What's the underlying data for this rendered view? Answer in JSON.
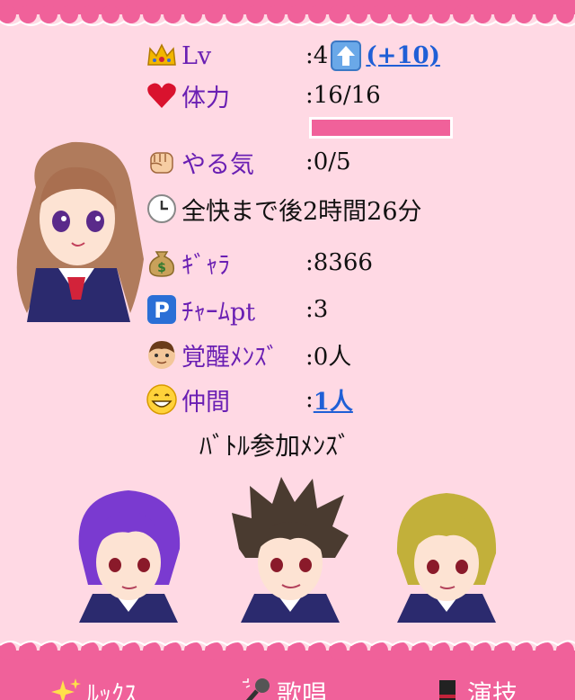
{
  "status": {
    "lv": {
      "label": "Lv",
      "value": ":4",
      "bonus": "(+10)",
      "icon": "crown-icon"
    },
    "hp": {
      "label": "体力",
      "value": ":16/16",
      "icon": "heart-icon",
      "fill_fraction": 1.0,
      "bar_color": "#f0619a"
    },
    "motivation": {
      "label": "やる気",
      "value": ":0/5",
      "icon": "fist-icon"
    },
    "recovery": {
      "text": "全快まで後2時間26分",
      "icon": "clock-icon"
    },
    "gyara": {
      "label": "ｷﾞｬﾗ",
      "value": ":8366",
      "icon": "money-bag-icon"
    },
    "charm": {
      "label": "ﾁｬｰﾑpt",
      "value": ":3",
      "icon": "parking-p-icon"
    },
    "awakened": {
      "label": "覚醒ﾒﾝｽﾞ",
      "value": ":0人",
      "icon": "boy-face-icon"
    },
    "friends": {
      "label": "仲間",
      "value_prefix": ":",
      "value_link": "1人",
      "icon": "grin-face-icon"
    }
  },
  "battle": {
    "title": "ﾊﾞﾄﾙ参加ﾒﾝｽﾞ"
  },
  "nav": {
    "looks": {
      "label": "ﾙｯｸｽ",
      "icon": "sparkles-icon"
    },
    "singing": {
      "label": "歌唱",
      "icon": "microphone-icon"
    },
    "acting": {
      "label": "演技",
      "icon": "top-hat-icon"
    }
  },
  "colors": {
    "background": "#ffd9e4",
    "accent_pink": "#f0619a",
    "label_purple": "#6a1fb3",
    "link_blue": "#1f5fd6"
  }
}
